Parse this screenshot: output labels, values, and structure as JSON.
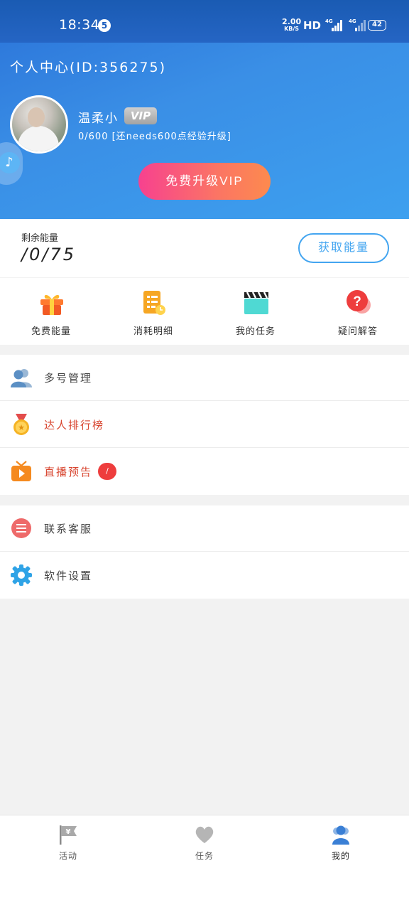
{
  "status_bar": {
    "time": "18:34",
    "notification_count": "5",
    "speed_value": "2.00",
    "speed_unit": "KB/S",
    "hd": "HD",
    "network1": "4G",
    "network2": "4G",
    "battery": "42"
  },
  "header": {
    "title": "个人中心(ID:356275)",
    "nickname": "温柔小",
    "vip_label": "VIP",
    "exp_text": "0/600 [还needs600点经验升级]",
    "upgrade_button": "免费升级VIP",
    "music_icon": "music-note-icon"
  },
  "energy": {
    "label": "剩余能量",
    "value": "/0/75",
    "get_button": "获取能量"
  },
  "quick_actions": [
    {
      "label": "免费能量",
      "icon": "gift-icon"
    },
    {
      "label": "消耗明细",
      "icon": "checklist-icon"
    },
    {
      "label": "我的任务",
      "icon": "clapperboard-icon"
    },
    {
      "label": "疑问解答",
      "icon": "question-bubble-icon"
    }
  ],
  "menu_group1": [
    {
      "label": "多号管理",
      "icon": "users-icon",
      "color": "#444444"
    },
    {
      "label": "达人排行榜",
      "icon": "medal-icon",
      "color": "#d8452f"
    },
    {
      "label": "直播预告",
      "icon": "tv-icon",
      "color": "#d8452f",
      "badge": "/"
    }
  ],
  "menu_group2": [
    {
      "label": "联系客服",
      "icon": "chat-icon",
      "color": "#444444"
    },
    {
      "label": "软件设置",
      "icon": "gear-icon",
      "color": "#444444"
    }
  ],
  "tabs": [
    {
      "label": "活动",
      "icon": "flag-yen-icon"
    },
    {
      "label": "任务",
      "icon": "heart-icon"
    },
    {
      "label": "我的",
      "icon": "person-icon",
      "active": true
    }
  ],
  "colors": {
    "header_blue": "#3a8fe6",
    "accent_blue": "#43a5f0",
    "upgrade_pink": "#f7418f",
    "upgrade_orange": "#fd8a4e",
    "alert_red": "#d8452f"
  }
}
